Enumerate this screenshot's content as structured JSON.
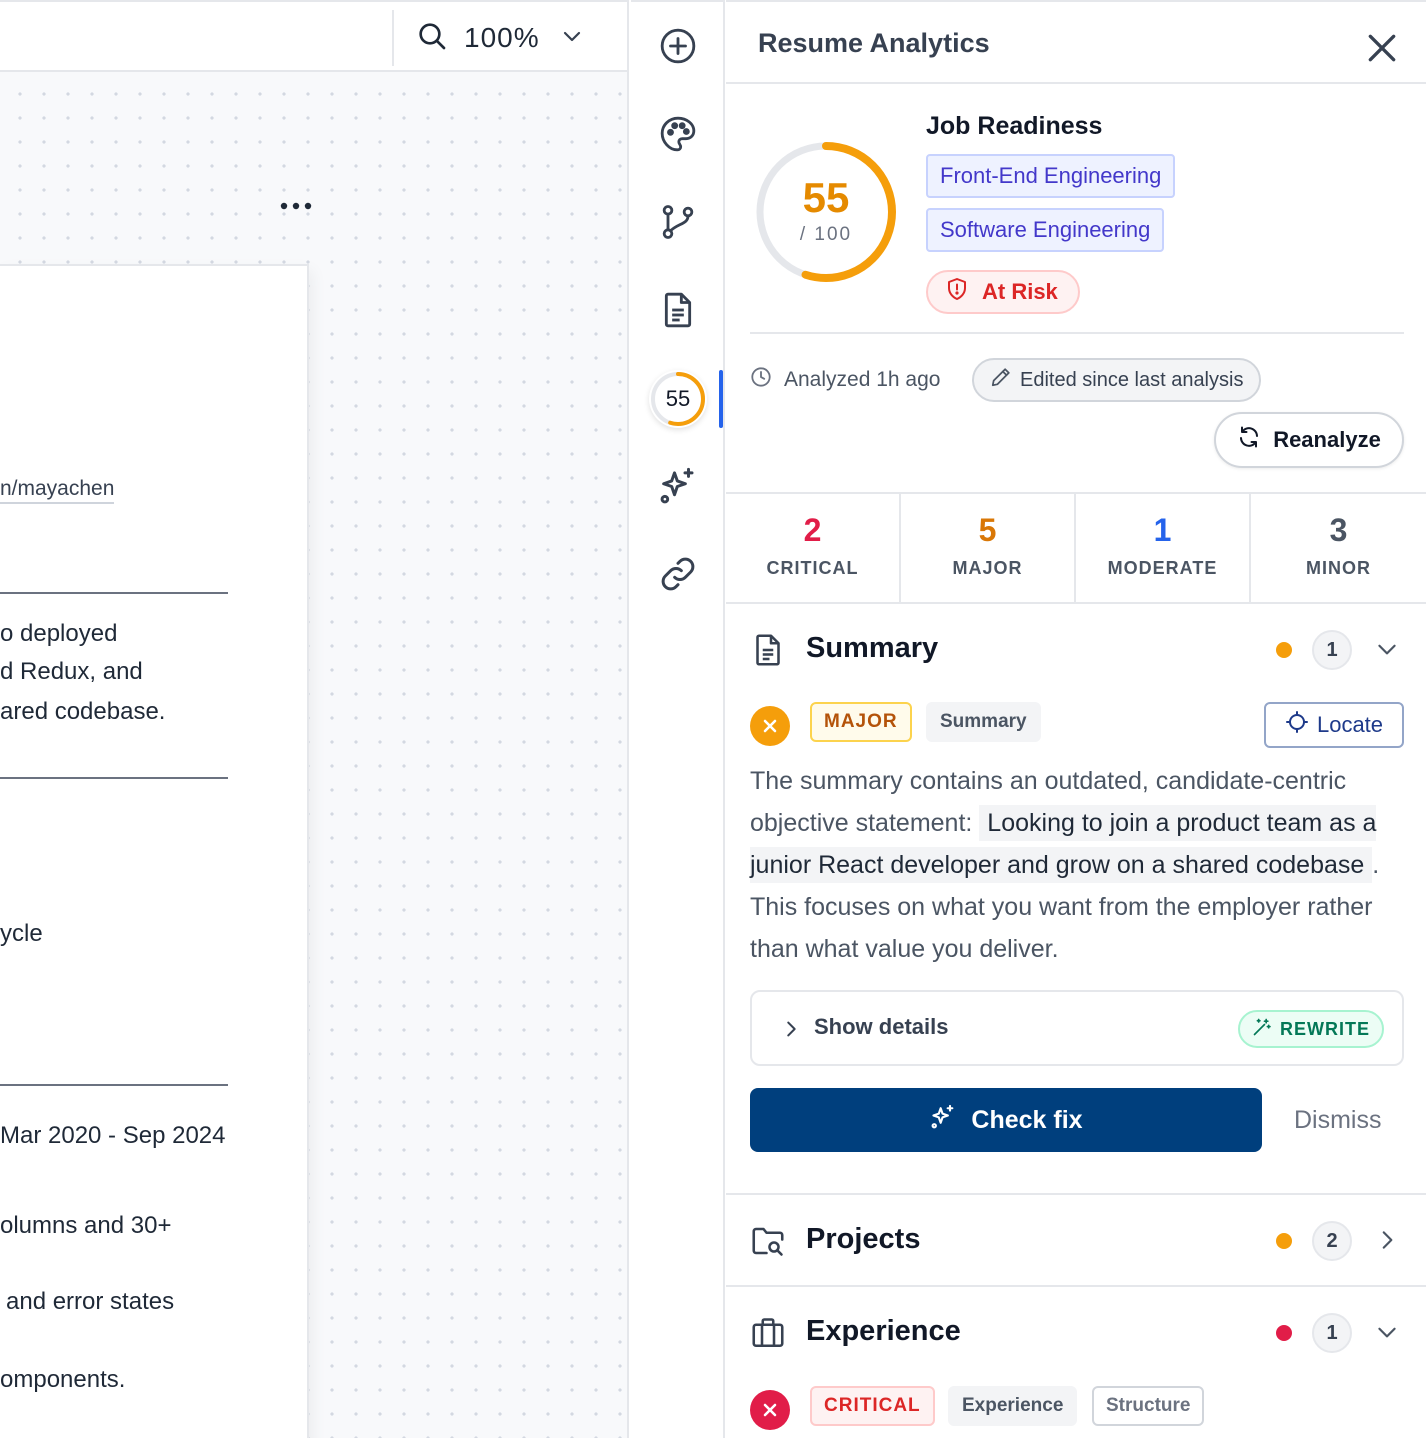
{
  "toolbar": {
    "zoom_level": "100%"
  },
  "document": {
    "link_text": "n/mayachen",
    "lines": [
      "o deployed",
      "d Redux, and",
      "ared codebase.",
      "ycle",
      "Mar 2020 - Sep 2024",
      "olumns and 30+",
      "and error states",
      "omponents."
    ]
  },
  "rail": {
    "score": "55"
  },
  "panel": {
    "title": "Resume Analytics",
    "score": {
      "value": 55,
      "max_label": "/ 100",
      "color": "#f59e0b"
    },
    "readiness_title": "Job Readiness",
    "roles": [
      "Front-End Engineering",
      "Software Engineering"
    ],
    "status": "At Risk",
    "analyzed": "Analyzed 1h ago",
    "edited": "Edited since last analysis",
    "reanalyze_label": "Reanalyze",
    "severity": [
      {
        "count": "2",
        "label": "CRITICAL",
        "color": "#e11d48"
      },
      {
        "count": "5",
        "label": "MAJOR",
        "color": "#d97706"
      },
      {
        "count": "1",
        "label": "MODERATE",
        "color": "#2563eb"
      },
      {
        "count": "3",
        "label": "MINOR",
        "color": "#4b5563"
      }
    ],
    "sections": {
      "summary": {
        "title": "Summary",
        "count": "1",
        "dot_color": "#f59e0b"
      },
      "projects": {
        "title": "Projects",
        "count": "2",
        "dot_color": "#f59e0b"
      },
      "experience": {
        "title": "Experience",
        "count": "1",
        "dot_color": "#e11d48"
      }
    },
    "summary_issue": {
      "severity": "MAJOR",
      "category": "Summary",
      "locate_label": "Locate",
      "text_before": "The summary contains an outdated, candidate-centric objective statement: ",
      "quote": "Looking to join a product team as a junior React developer and grow on a shared codebase",
      "text_after": ". This focuses on what you want from the employer rather than what value you deliver.",
      "details_label": "Show details",
      "rewrite_label": "REWRITE",
      "check_fix_label": "Check fix",
      "dismiss_label": "Dismiss"
    },
    "experience_issue": {
      "severity": "CRITICAL",
      "tags": [
        "Experience",
        "Structure"
      ]
    }
  }
}
